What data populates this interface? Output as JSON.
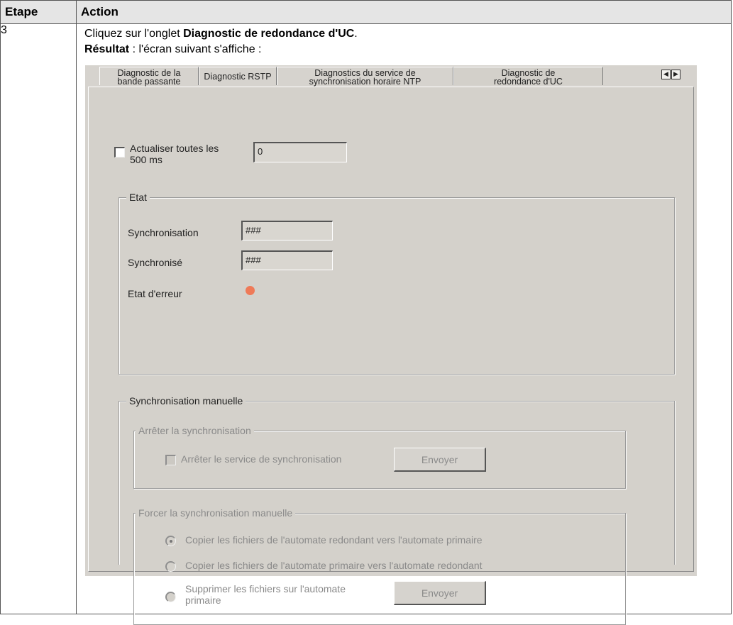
{
  "table": {
    "headers": [
      "Etape",
      "Action"
    ],
    "step": "3",
    "instruction_prefix": "Cliquez sur l'onglet ",
    "instruction_bold": "Diagnostic de redondance d'UC",
    "instruction_suffix": ".",
    "result_bold": "Résultat",
    "result_text": " : l'écran suivant s'affiche :"
  },
  "tabs": [
    {
      "line1": "Diagnostic de la",
      "line2": "bande passante",
      "active": false
    },
    {
      "line1": "Diagnostic RSTP",
      "line2": "",
      "active": false
    },
    {
      "line1": "Diagnostics du service de",
      "line2": "synchronisation horaire NTP",
      "active": false
    },
    {
      "line1": "Diagnostic de",
      "line2": "redondance d'UC",
      "active": true
    }
  ],
  "refresh": {
    "label_line1": "Actualiser toutes les",
    "label_line2": "500 ms",
    "value": "0",
    "checked": false
  },
  "etat": {
    "legend": "Etat",
    "synchronisation_label": "Synchronisation",
    "synchronisation_value": "###",
    "synchronise_label": "Synchronisé",
    "synchronise_value": "###",
    "erreur_label": "Etat d'erreur",
    "erreur_led_color": "#ef7a58"
  },
  "manual": {
    "legend": "Synchronisation manuelle",
    "stop_group": {
      "legend": "Arrêter la synchronisation",
      "checkbox_label": "Arrêter le service de synchronisation",
      "button": "Envoyer"
    },
    "force_group": {
      "legend": "Forcer la synchronisation manuelle",
      "options": [
        "Copier les fichiers de l'automate redondant vers l'automate primaire",
        "Copier les fichiers de l'automate primaire vers l'automate redondant",
        "Supprimer les fichiers sur l'automate primaire"
      ],
      "option3_line1": "Supprimer les fichiers sur l'automate",
      "option3_line2": "primaire",
      "selected_index": 0,
      "button": "Envoyer"
    }
  }
}
